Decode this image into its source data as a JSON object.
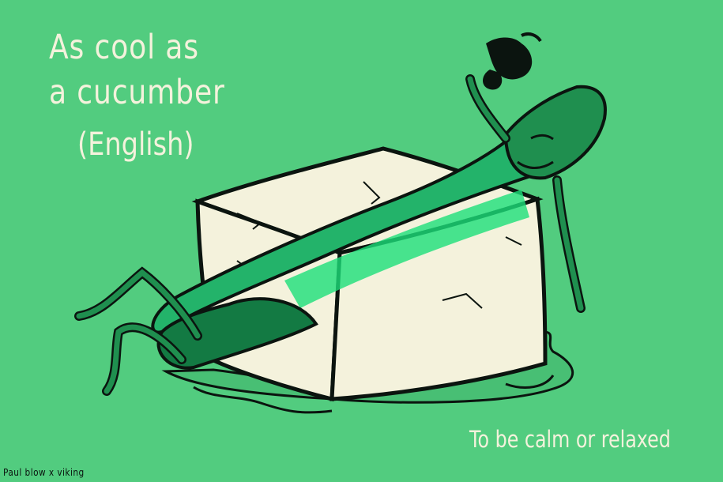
{
  "title": {
    "line1": "As cool as",
    "line2": "a cucumber"
  },
  "language": "(English)",
  "meaning": "To be calm or relaxed",
  "credit": "Paul blow x viking",
  "colors": {
    "background": "#52cc7f",
    "ice": "#f4f2dc",
    "cucumber": "#23b36a",
    "cucumber_dark": "#0f6e3f",
    "text": "#f4f2dc",
    "outline": "#0b140f"
  },
  "icons": [
    "sunglasses-icon"
  ]
}
